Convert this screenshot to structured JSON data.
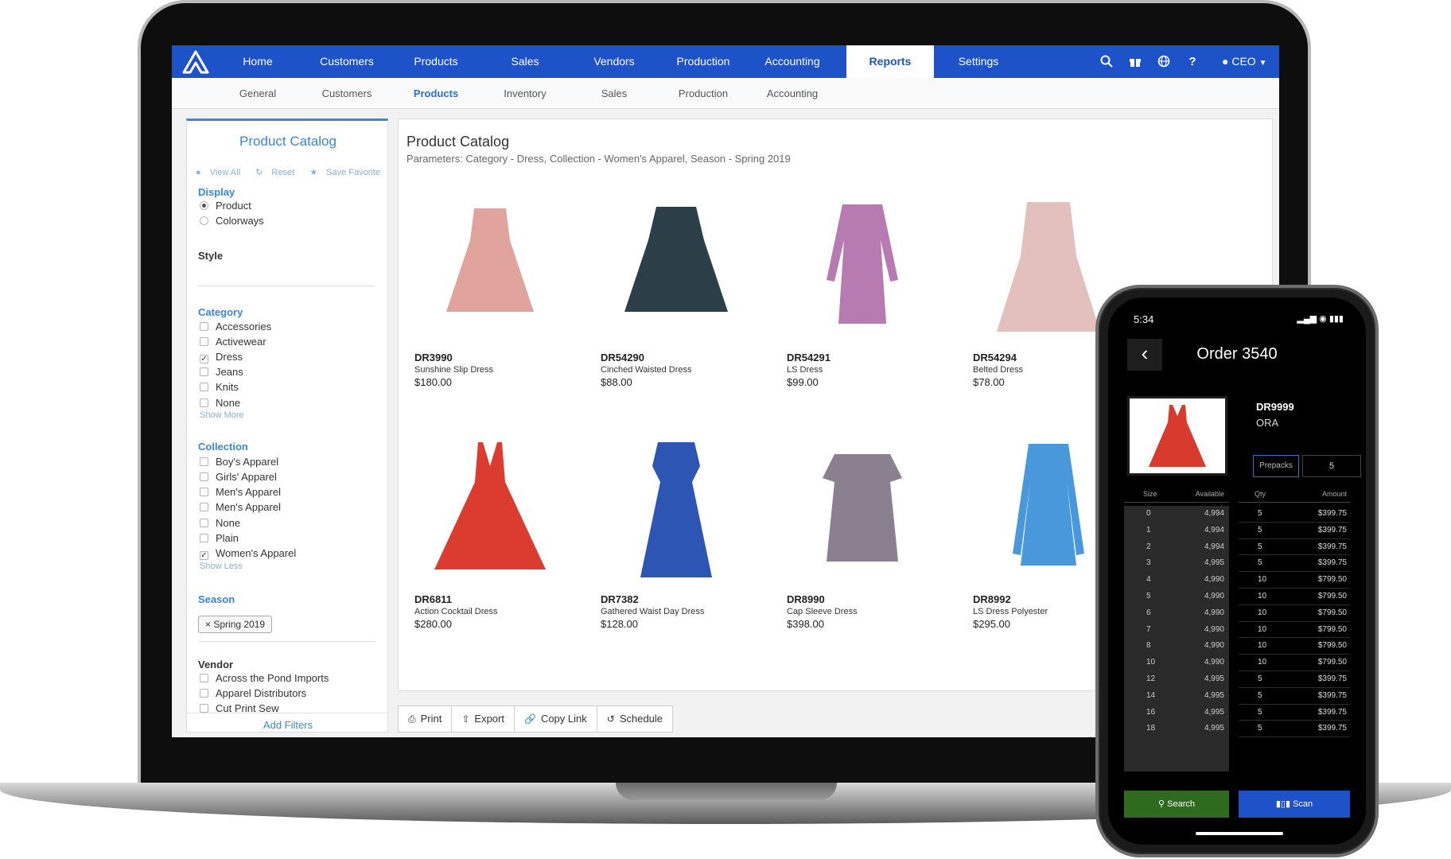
{
  "nav": {
    "items": [
      "Home",
      "Customers",
      "Products",
      "Sales",
      "Vendors",
      "Production",
      "Accounting",
      "Reports",
      "Settings"
    ],
    "active": "Reports",
    "user": "CEO"
  },
  "subnav": {
    "items": [
      "General",
      "Customers",
      "Products",
      "Inventory",
      "Sales",
      "Production",
      "Accounting"
    ],
    "active": "Products"
  },
  "filters": {
    "title": "Product Catalog",
    "links": [
      "View All",
      "Reset",
      "Save Favorite"
    ],
    "display_label": "Display",
    "display_options": [
      "Product",
      "Colorways"
    ],
    "style_label": "Style",
    "category_label": "Category",
    "categories": [
      "Accessories",
      "Activewear",
      "Dress",
      "Jeans",
      "Knits",
      "None"
    ],
    "show_more": "Show More",
    "collection_label": "Collection",
    "collections": [
      "Boy's Apparel",
      "Girls' Apparel",
      "Men's Apparel",
      "Men's Apparel",
      "None",
      "Plain",
      "Women's Apparel"
    ],
    "show_less": "Show Less",
    "season_label": "Season",
    "season_chip": "Spring 2019",
    "vendor_label": "Vendor",
    "vendors": [
      "Across the Pond Imports",
      "Apparel Distributors",
      "Cut Print Sew"
    ],
    "add_filters": "Add Filters"
  },
  "catalog": {
    "title": "Product Catalog",
    "params": "Parameters: Category - Dress, Collection - Women's Apparel, Season - Spring 2019",
    "products": [
      {
        "code": "DR3990",
        "name": "Sunshine Slip Dress",
        "price": "$180.00",
        "color": "#e0a49c"
      },
      {
        "code": "DR54290",
        "name": "Cinched Waisted Dress",
        "price": "$88.00",
        "color": "#2c3f48"
      },
      {
        "code": "DR54291",
        "name": "LS Dress",
        "price": "$99.00",
        "color": "#b77bb1"
      },
      {
        "code": "DR54294",
        "name": "Belted Dress",
        "price": "$78.00",
        "color": "#e3c0bd"
      },
      {
        "code": "DR6811",
        "name": "Action Cocktail Dress",
        "price": "$280.00",
        "color": "#dc3c30"
      },
      {
        "code": "DR7382",
        "name": "Gathered Waist Day Dress",
        "price": "$128.00",
        "color": "#2d55b4"
      },
      {
        "code": "DR8990",
        "name": "Cap Sleeve Dress",
        "price": "$398.00",
        "color": "#8a8090"
      },
      {
        "code": "DR8992",
        "name": "LS Dress Polyester",
        "price": "$295.00",
        "color": "#4a98dc"
      }
    ]
  },
  "toolbar": {
    "print": "Print",
    "export": "Export",
    "copy_link": "Copy Link",
    "schedule": "Schedule"
  },
  "phone": {
    "time": "5:34",
    "title": "Order 3540",
    "sku": "DR9999",
    "color": "ORA",
    "prepacks_label": "Prepacks",
    "prepacks_value": "5",
    "col_size": "Size",
    "col_available": "Available",
    "col_qty": "Qty",
    "col_amount": "Amount",
    "rows": [
      {
        "size": "0",
        "available": "4,994",
        "qty": "5",
        "amount": "$399.75"
      },
      {
        "size": "1",
        "available": "4,994",
        "qty": "5",
        "amount": "$399.75"
      },
      {
        "size": "2",
        "available": "4,994",
        "qty": "5",
        "amount": "$399.75"
      },
      {
        "size": "3",
        "available": "4,995",
        "qty": "5",
        "amount": "$399.75"
      },
      {
        "size": "4",
        "available": "4,990",
        "qty": "10",
        "amount": "$799.50"
      },
      {
        "size": "5",
        "available": "4,990",
        "qty": "10",
        "amount": "$799.50"
      },
      {
        "size": "6",
        "available": "4,990",
        "qty": "10",
        "amount": "$799.50"
      },
      {
        "size": "7",
        "available": "4,990",
        "qty": "10",
        "amount": "$799.50"
      },
      {
        "size": "8",
        "available": "4,990",
        "qty": "10",
        "amount": "$799.50"
      },
      {
        "size": "10",
        "available": "4,990",
        "qty": "10",
        "amount": "$799.50"
      },
      {
        "size": "12",
        "available": "4,995",
        "qty": "5",
        "amount": "$399.75"
      },
      {
        "size": "14",
        "available": "4,995",
        "qty": "5",
        "amount": "$399.75"
      },
      {
        "size": "16",
        "available": "4,995",
        "qty": "5",
        "amount": "$399.75"
      },
      {
        "size": "18",
        "available": "4,995",
        "qty": "5",
        "amount": "$399.75"
      }
    ],
    "search_label": "Search",
    "scan_label": "Scan",
    "search_color": "#2f6b1f",
    "scan_color": "#1d52c9"
  }
}
